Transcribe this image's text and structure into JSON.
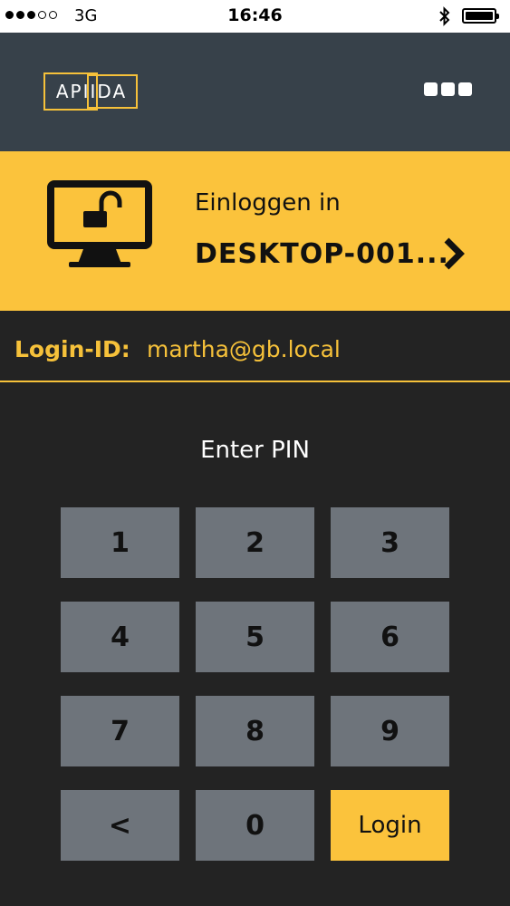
{
  "status_bar": {
    "carrier": "3G",
    "time": "16:46",
    "signal_dots_filled": 3,
    "signal_dots_total": 5
  },
  "header": {
    "logo_text": "APIIDA"
  },
  "target": {
    "label": "Einloggen in",
    "name": "DESKTOP-001..."
  },
  "login": {
    "label": "Login-ID:",
    "value": "martha@gb.local"
  },
  "pin": {
    "label": "Enter PIN"
  },
  "keypad": {
    "keys": [
      "1",
      "2",
      "3",
      "4",
      "5",
      "6",
      "7",
      "8",
      "9",
      "<",
      "0",
      "Login"
    ]
  },
  "colors": {
    "accent": "#fbc33c",
    "header_bg": "#37414a",
    "page_bg": "#232323",
    "key_bg": "#6e747b"
  }
}
